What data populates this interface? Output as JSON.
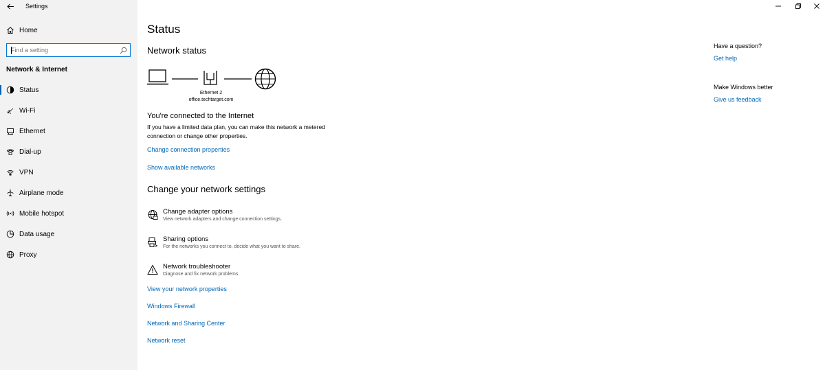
{
  "window": {
    "title": "Settings",
    "controls": [
      "minimize-icon",
      "restore-icon",
      "close-icon"
    ]
  },
  "sidebar": {
    "home_label": "Home",
    "search_placeholder": "Find a setting",
    "section_heading": "Network & Internet",
    "items": [
      {
        "label": "Status",
        "icon": "status-icon",
        "active": true
      },
      {
        "label": "Wi-Fi",
        "icon": "wifi-icon"
      },
      {
        "label": "Ethernet",
        "icon": "ethernet-icon"
      },
      {
        "label": "Dial-up",
        "icon": "dialup-icon"
      },
      {
        "label": "VPN",
        "icon": "vpn-icon"
      },
      {
        "label": "Airplane mode",
        "icon": "airplane-icon"
      },
      {
        "label": "Mobile hotspot",
        "icon": "hotspot-icon"
      },
      {
        "label": "Data usage",
        "icon": "data-usage-icon"
      },
      {
        "label": "Proxy",
        "icon": "proxy-icon"
      }
    ]
  },
  "main": {
    "title": "Status",
    "network_status_heading": "Network status",
    "adapter_name": "Ethernet 2",
    "adapter_domain": "office.techtarget.com",
    "connection_title": "You're connected to the Internet",
    "connection_desc": "If you have a limited data plan, you can make this network a metered connection or change other properties.",
    "links_top": [
      "Change connection properties",
      "Show available networks"
    ],
    "change_heading": "Change your network settings",
    "options": [
      {
        "title": "Change adapter options",
        "desc": "View network adapters and change connection settings.",
        "icon": "adapter-icon"
      },
      {
        "title": "Sharing options",
        "desc": "For the networks you connect to, decide what you want to share.",
        "icon": "sharing-icon"
      },
      {
        "title": "Network troubleshooter",
        "desc": "Diagnose and fix network problems.",
        "icon": "warning-icon"
      }
    ],
    "links_bottom": [
      "View your network properties",
      "Windows Firewall",
      "Network and Sharing Center",
      "Network reset"
    ]
  },
  "right": {
    "question_title": "Have a question?",
    "get_help": "Get help",
    "better_title": "Make Windows better",
    "feedback": "Give us feedback"
  },
  "colors": {
    "accent": "#0067b8",
    "sidebar_bg": "#f2f2f2",
    "search_border": "#0078d7"
  }
}
